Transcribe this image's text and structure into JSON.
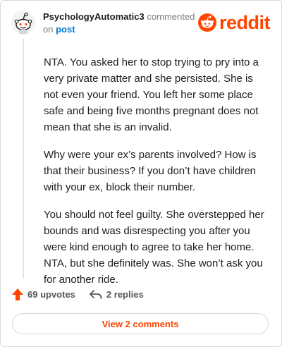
{
  "comment": {
    "author": "PsychologyAutomatic3",
    "verb": "commented",
    "on_text": "on",
    "post_link": "post",
    "paragraphs": [
      "NTA. You asked her to stop trying to pry into a very private matter and she persisted. She is not even your friend. You left her some place safe and being five months pregnant does not mean that she is an invalid.",
      "Why were your ex’s parents involved? How is that their business? If you don’t have children with your ex, block their number.",
      "You should not feel guilty. She overstepped her bounds and was disrespecting you after you were kind enough to agree to take her home. NTA, but she definitely was. She won’t ask you for another ride."
    ]
  },
  "brand": {
    "wordmark": "reddit",
    "accent": "#ff4500"
  },
  "actions": {
    "upvotes_label": "69 upvotes",
    "replies_label": "2 replies",
    "upvote_icon": "upvote-arrow-icon",
    "reply_icon": "reply-arrow-icon"
  },
  "footer": {
    "view_comments_label": "View 2 comments"
  }
}
